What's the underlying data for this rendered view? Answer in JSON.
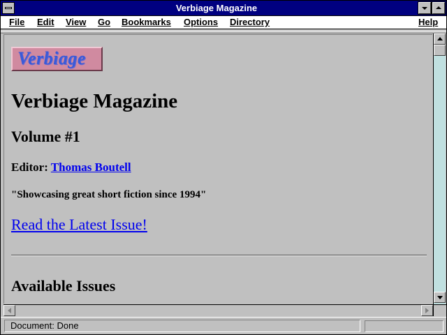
{
  "window": {
    "title": "Verbiage Magazine"
  },
  "menubar": {
    "items": [
      {
        "label": "File"
      },
      {
        "label": "Edit"
      },
      {
        "label": "View"
      },
      {
        "label": "Go"
      },
      {
        "label": "Bookmarks"
      },
      {
        "label": "Options"
      },
      {
        "label": "Directory"
      },
      {
        "label": "Help"
      }
    ]
  },
  "page": {
    "logo_text": "Verbiage",
    "heading": "Verbiage Magazine",
    "volume": "Volume #1",
    "editor_label": "Editor:",
    "editor_name": "Thomas Boutell",
    "tagline": "\"Showcasing great short fiction since 1994\"",
    "latest_link": "Read the Latest Issue!",
    "section_heading": "Available Issues"
  },
  "statusbar": {
    "text": "Document: Done"
  },
  "colors": {
    "titlebar": "#000080",
    "link": "#0000ee",
    "logo_bg": "#d08aa0",
    "logo_text": "#3a5ad8"
  }
}
